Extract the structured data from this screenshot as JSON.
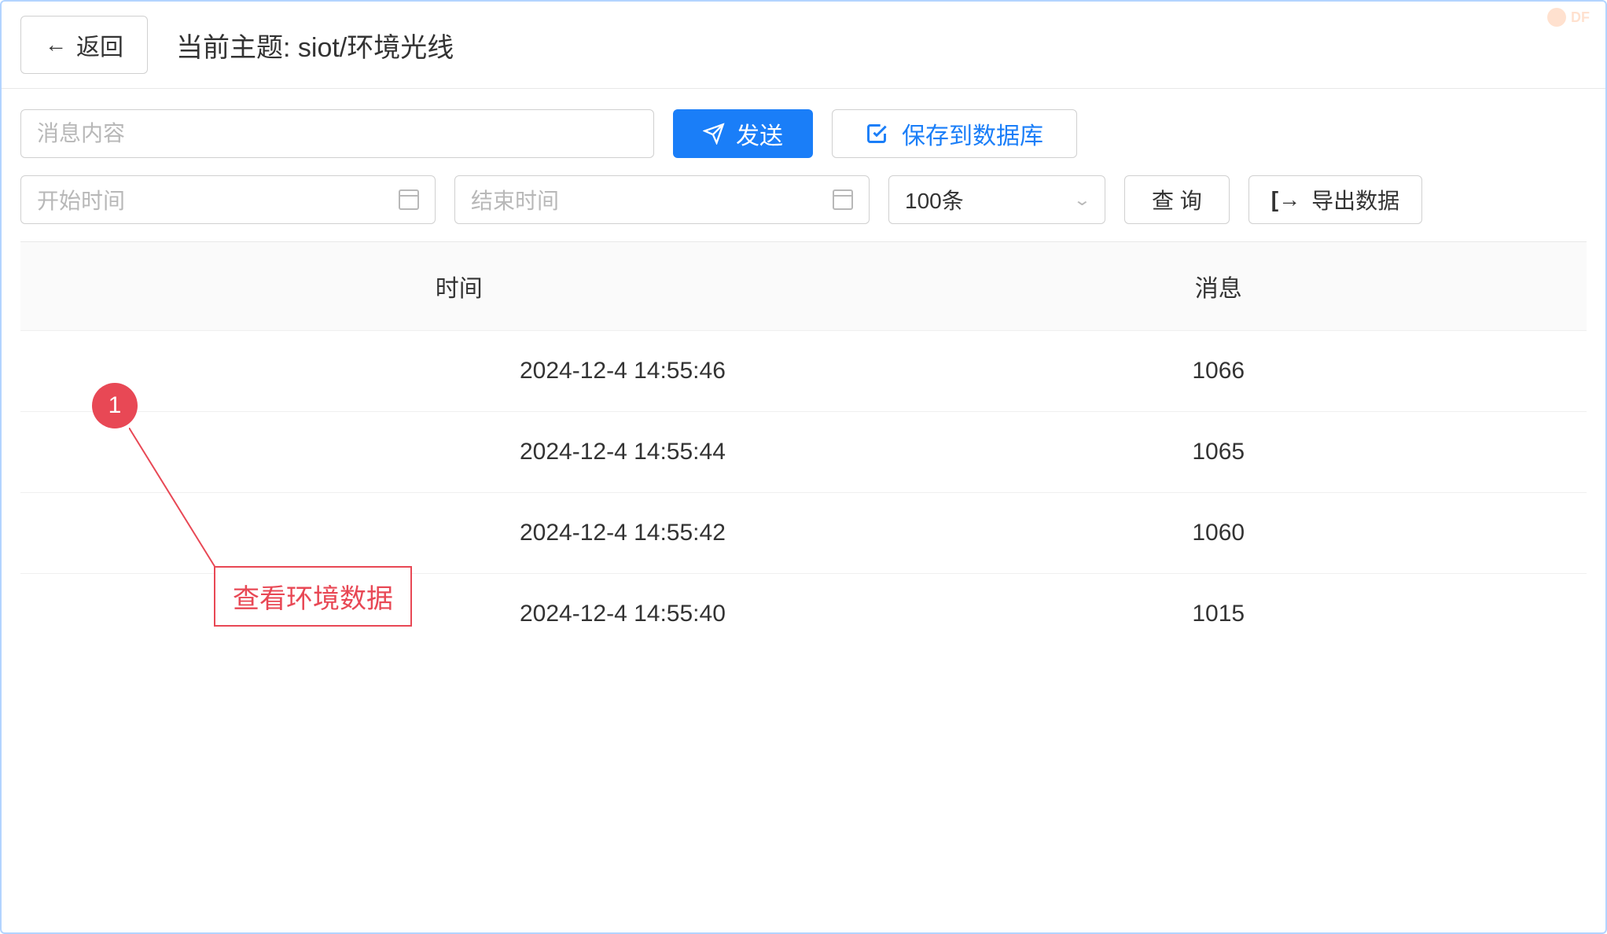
{
  "watermark": {
    "text": "DF"
  },
  "header": {
    "back_label": "返回",
    "title": "当前主题: siot/环境光线"
  },
  "inputs": {
    "message_placeholder": "消息内容",
    "start_time_placeholder": "开始时间",
    "end_time_placeholder": "结束时间"
  },
  "buttons": {
    "send": "发送",
    "save_db": "保存到数据库",
    "query": "查 询",
    "export": "导出数据"
  },
  "select": {
    "count_value": "100条"
  },
  "table": {
    "headers": {
      "time": "时间",
      "message": "消息"
    },
    "rows": [
      {
        "time": "2024-12-4 14:55:46",
        "message": "1066"
      },
      {
        "time": "2024-12-4 14:55:44",
        "message": "1065"
      },
      {
        "time": "2024-12-4 14:55:42",
        "message": "1060"
      },
      {
        "time": "2024-12-4 14:55:40",
        "message": "1015"
      }
    ]
  },
  "annotation": {
    "number": "1",
    "label": "查看环境数据"
  }
}
